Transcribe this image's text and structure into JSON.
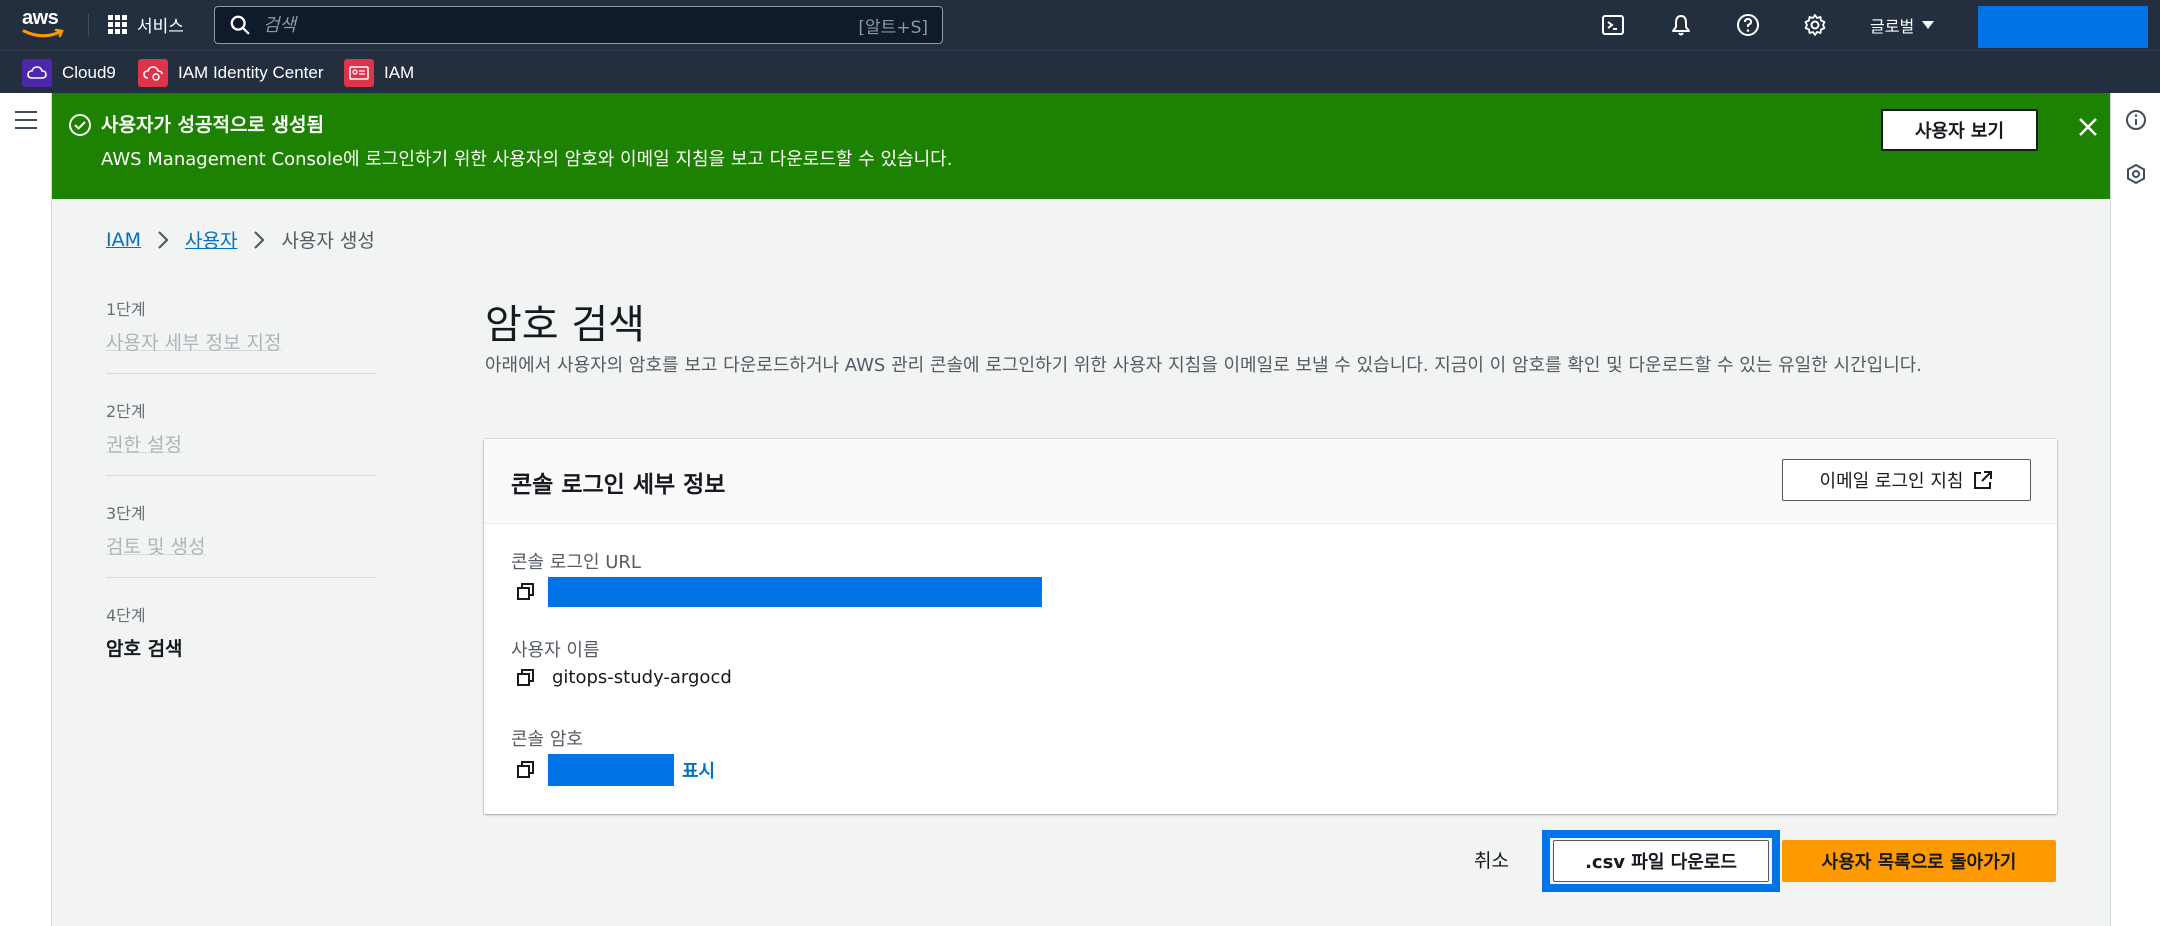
{
  "topnav": {
    "logo_text": "aws",
    "services_label": "서비스",
    "search_placeholder": "검색",
    "search_shortcut": "[알트+S]",
    "region_label": "글로벌",
    "colors": {
      "bg": "#232f3e",
      "redaction": "#0073e6"
    }
  },
  "favorites": [
    {
      "label": "Cloud9",
      "icon": "cloud9-icon",
      "color": "#4d27aa"
    },
    {
      "label": "IAM Identity Center",
      "icon": "iam-identity-center-icon",
      "color": "#dd344c"
    },
    {
      "label": "IAM",
      "icon": "iam-icon",
      "color": "#dd344c"
    }
  ],
  "flash": {
    "title": "사용자가 성공적으로 생성됨",
    "message": "AWS Management Console에 로그인하기 위한 사용자의 암호와 이메일 지침을 보고 다운로드할 수 있습니다.",
    "view_button": "사용자 보기",
    "color": "#1d8102"
  },
  "breadcrumb": {
    "items": [
      "IAM",
      "사용자"
    ],
    "current": "사용자 생성"
  },
  "steps": [
    {
      "num": "1단계",
      "label": "사용자 세부 정보 지정"
    },
    {
      "num": "2단계",
      "label": "권한 설정"
    },
    {
      "num": "3단계",
      "label": "검토 및 생성"
    },
    {
      "num": "4단계",
      "label": "암호 검색"
    }
  ],
  "main": {
    "title": "암호 검색",
    "description": "아래에서 사용자의 암호를 보고 다운로드하거나 AWS 관리 콘솔에 로그인하기 위한 사용자 지침을 이메일로 보낼 수 있습니다. 지금이 이 암호를 확인 및 다운로드할 수 있는 유일한 시간입니다."
  },
  "panel": {
    "title": "콘솔 로그인 세부 정보",
    "email_button": "이메일 로그인 지침",
    "url_label": "콘솔 로그인 URL",
    "username_label": "사용자 이름",
    "username_value": "gitops-study-argocd",
    "password_label": "콘솔 암호",
    "show_link": "표시"
  },
  "actions": {
    "cancel": "취소",
    "download_csv": ".csv 파일 다운로드",
    "return_to_list": "사용자 목록으로 돌아가기",
    "primary_color": "#ff9900"
  }
}
